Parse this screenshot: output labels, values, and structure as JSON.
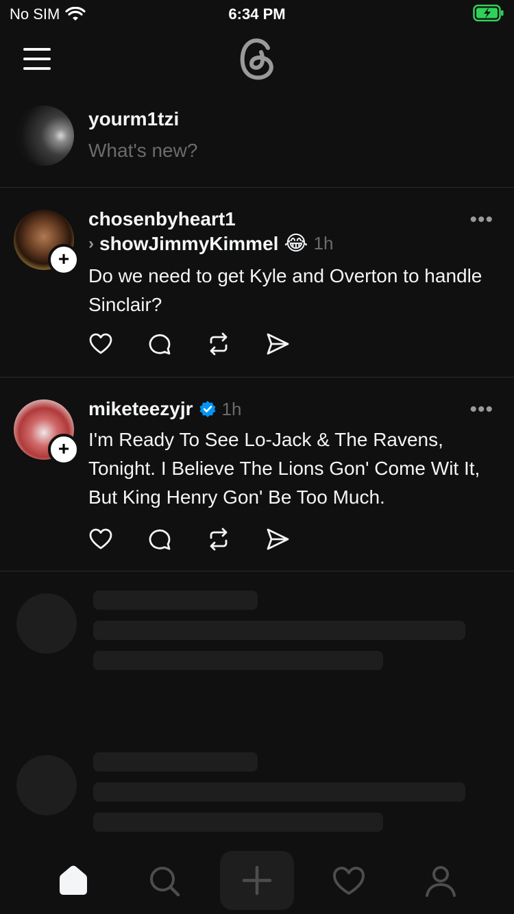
{
  "status_bar": {
    "carrier": "No SIM",
    "time": "6:34 PM"
  },
  "header": {
    "menu_icon": "hamburger-icon",
    "logo": "threads-logo"
  },
  "composer": {
    "username": "yourm1tzi",
    "placeholder": "What's new?"
  },
  "posts": [
    {
      "author": "chosenbyheart1",
      "reply_to": "showJimmyKimmel",
      "emoji": "😂",
      "time": "1h",
      "text": "Do we need to get Kyle and Overton to handle Sinclair?",
      "more": "•••"
    },
    {
      "author": "miketeezyjr",
      "verified": true,
      "time": "1h",
      "text": "I'm Ready To See Lo-Jack & The Ravens, Tonight. I Believe The Lions Gon' Come Wit It, But King Henry Gon' Be Too Much.",
      "more": "•••"
    }
  ],
  "tabs": [
    {
      "icon": "home-icon",
      "active": true
    },
    {
      "icon": "search-icon"
    },
    {
      "icon": "plus-icon"
    },
    {
      "icon": "heart-icon"
    },
    {
      "icon": "profile-icon"
    }
  ],
  "colors": {
    "background": "#101010",
    "text": "#f3f5f7",
    "muted": "#6b6b6b",
    "verified": "#0095f6",
    "battery": "#30d158"
  }
}
